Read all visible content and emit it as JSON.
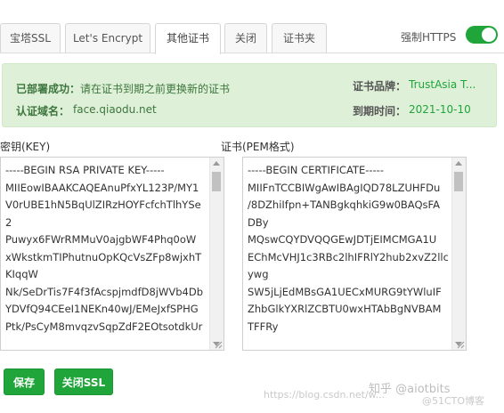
{
  "tabs": [
    {
      "label": "宝塔SSL"
    },
    {
      "label": "Let's Encrypt"
    },
    {
      "label": "其他证书"
    },
    {
      "label": "关闭"
    },
    {
      "label": "证书夹"
    }
  ],
  "force_https": {
    "label": "强制HTTPS",
    "enabled": true
  },
  "status": {
    "deployed_key": "已部署成功：",
    "deployed_value": "请在证书到期之前更换新的证书",
    "domain_key": "认证域名：",
    "domain_value": "face.qiaodu.net",
    "brand_key": "证书品牌：",
    "brand_value": "TrustAsia T...",
    "expire_key": "到期时间：",
    "expire_value": "2021-10-10"
  },
  "key_panel": {
    "label": "密钥(KEY)",
    "lines": [
      "-----BEGIN RSA PRIVATE KEY-----",
      "MIIEowIBAAKCAQEAnuPfxYL123P/MY1",
      "V0rUBE1hN5BqUlZIRzHOYFcfchTlhYSe",
      "2",
      "Puwyx6FWrRMMuV0ajgbWF4Phq0oW",
      "xWkstkmTIPhutnuOpKQcVsZFp8wjxhT",
      "KIqqW",
      "Nk/SeDrTis7F4f3fAcspjmdfD8jWVb4Db",
      "YDVfQ94CEeI1NEKn40wJ/EMeJxfSPHG",
      "Ptk/PsCyM8mvqzvSqpZdF2EOtsotdkUr"
    ]
  },
  "cert_panel": {
    "label": "证书(PEM格式)",
    "lines": [
      "-----BEGIN CERTIFICATE-----",
      "MIIFnTCCBIWgAwIBAgIQD78LZUHFDu",
      "/8DZhiIfpn+TANBgkqhkiG9w0BAQsFA",
      "DBy",
      "MQswCQYDVQQGEwJDTjEIMCMGA1U",
      "EChMcVHJ1c3RBc2lhIFRlY2hub2xvZ2llc",
      "ywg",
      "SW5jLjEdMBsGA1UECxMURG9tYWluIF",
      "ZhbGlkYXRlZCBTU0wxHTAbBgNVBAM",
      "TFFRy"
    ]
  },
  "buttons": {
    "save": "保存",
    "close_ssl": "关闭SSL"
  },
  "watermark": {
    "url": "https://blog.csdn.net/w...",
    "brand": "知乎 @aiotbits",
    "sub": "@51CTO博客"
  },
  "colors": {
    "accent": "#20a53a",
    "banner_bg": "#dff0d8",
    "banner_text": "#3c763d"
  }
}
